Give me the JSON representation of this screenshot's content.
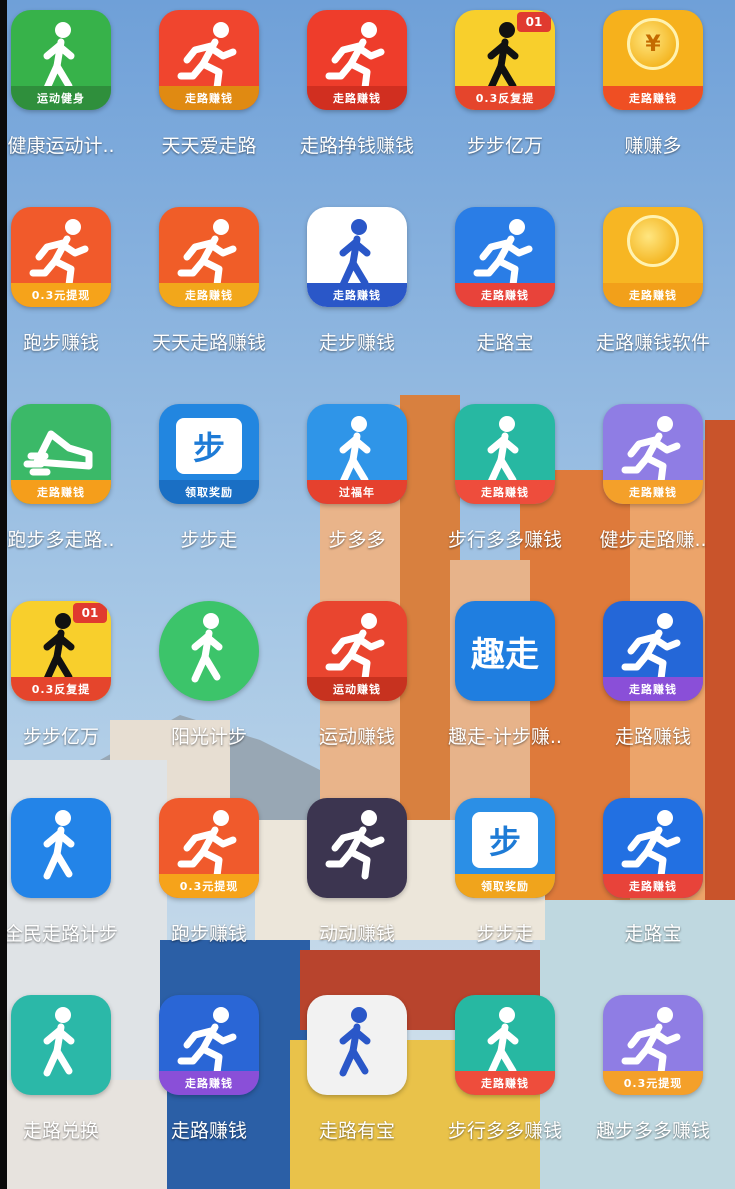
{
  "colors": {
    "sky_top": "#6fa0d8",
    "sky_bottom": "#cfe0ee",
    "building_orange": "#d9773a"
  },
  "apps": [
    {
      "label": "健康运动计..",
      "icon": "walker-icon",
      "bg": "#37b24a",
      "band": "运动健身",
      "band_color": "#2f8f3c"
    },
    {
      "label": "天天爱走路",
      "icon": "runner-icon",
      "bg": "#f0452e",
      "band": "走路赚钱",
      "band_color": "#e08a12"
    },
    {
      "label": "走路挣钱赚钱",
      "icon": "runner-icon",
      "bg": "#ee3d2b",
      "band": "走路赚钱",
      "band_color": "#d12f20"
    },
    {
      "label": "步步亿万",
      "icon": "walker-dark-icon",
      "bg": "#f8cf2c",
      "band": "0.3反复提",
      "band_color": "#e5452c",
      "badge": "01"
    },
    {
      "label": "赚赚多",
      "icon": "coin-icon",
      "bg": "#f6b11c",
      "band": "走路赚钱",
      "band_color": "#ef4f23",
      "coin": "¥"
    },
    {
      "label": "跑步赚钱",
      "icon": "runner-icon",
      "bg": "#f15a2b",
      "band": "0.3元提现",
      "band_color": "#f6a31a"
    },
    {
      "label": "天天走路赚钱",
      "icon": "runner-icon",
      "bg": "#f05d28",
      "band": "走路赚钱",
      "band_color": "#f2a71b"
    },
    {
      "label": "走步赚钱",
      "icon": "walker-blue-icon",
      "bg": "#ffffff",
      "band": "走路赚钱",
      "band_color": "#2a57c8"
    },
    {
      "label": "走路宝",
      "icon": "runner-icon",
      "bg": "#2a7de6",
      "band": "走路赚钱",
      "band_color": "#e8433a"
    },
    {
      "label": "走路赚钱软件",
      "icon": "coin-icon",
      "bg": "#f7b623",
      "band": "走路赚钱",
      "band_color": "#f2a01a"
    },
    {
      "label": "跑步多走路..",
      "icon": "shoe-icon",
      "bg": "#3bb968",
      "band": "走路赚钱",
      "band_color": "#f59e1b"
    },
    {
      "label": "步步走",
      "icon": "step-text-icon",
      "bg": "#2286e0",
      "band": "领取奖励",
      "band_color": "#1a6fc4",
      "text": "步"
    },
    {
      "label": "步多多",
      "icon": "walker-icon",
      "bg": "#2f95e8",
      "band": "过福年",
      "band_color": "#e5412e"
    },
    {
      "label": "步行多多赚钱",
      "icon": "walker-icon",
      "bg": "#27b8a2",
      "band": "走路赚钱",
      "band_color": "#ee4d3c"
    },
    {
      "label": "健步走路赚..",
      "icon": "runner-icon",
      "bg": "#8f7de4",
      "band": "走路赚钱",
      "band_color": "#f4a02a"
    },
    {
      "label": "步步亿万",
      "icon": "walker-dark-icon",
      "bg": "#f8cf2c",
      "band": "0.3反复提",
      "band_color": "#e5452c",
      "badge": "01"
    },
    {
      "label": "阳光计步",
      "icon": "walker-icon",
      "bg": "#3cc46a",
      "band": "",
      "band_color": "#3cc46a",
      "round": true
    },
    {
      "label": "运动赚钱",
      "icon": "runner-icon",
      "bg": "#e9452f",
      "band": "运动赚钱",
      "band_color": "#c7321f"
    },
    {
      "label": "趣走-计步赚..",
      "icon": "text-icon",
      "bg": "#1f7ee0",
      "band": "",
      "band_color": "#1f7ee0",
      "text": "趣走"
    },
    {
      "label": "走路赚钱",
      "icon": "runner-icon",
      "bg": "#2467d8",
      "band": "走路赚钱",
      "band_color": "#8a4fd8"
    },
    {
      "label": "全民走路计步",
      "icon": "walker-icon",
      "bg": "#2384e8",
      "band": "",
      "band_color": "#2384e8"
    },
    {
      "label": "跑步赚钱",
      "icon": "runner-icon",
      "bg": "#f05a2c",
      "band": "0.3元提现",
      "band_color": "#f6a31a"
    },
    {
      "label": "动动赚钱",
      "icon": "runner-icon",
      "bg": "#3c3550",
      "band": "",
      "band_color": "#3c3550"
    },
    {
      "label": "步步走",
      "icon": "step-text-icon",
      "bg": "#2b8fe6",
      "band": "领取奖励",
      "band_color": "#f0a41c",
      "text": "步"
    },
    {
      "label": "走路宝",
      "icon": "runner-icon",
      "bg": "#2270e2",
      "band": "走路赚钱",
      "band_color": "#e8433a"
    },
    {
      "label": "走路兑换",
      "icon": "walker-icon",
      "bg": "#2bb8a8",
      "band": "",
      "band_color": "#2bb8a8"
    },
    {
      "label": "走路赚钱",
      "icon": "runner-icon",
      "bg": "#2a66d6",
      "band": "走路赚钱",
      "band_color": "#8a4fd8"
    },
    {
      "label": "走路有宝",
      "icon": "walker-blue-icon",
      "bg": "#f2f2f2",
      "band": "",
      "band_color": "#f2f2f2"
    },
    {
      "label": "步行多多赚钱",
      "icon": "walker-icon",
      "bg": "#27b8a2",
      "band": "走路赚钱",
      "band_color": "#ee4d3c"
    },
    {
      "label": "趣步多多赚钱",
      "icon": "runner-icon",
      "bg": "#8f7de4",
      "band": "0.3元提现",
      "band_color": "#f4a02a"
    }
  ]
}
